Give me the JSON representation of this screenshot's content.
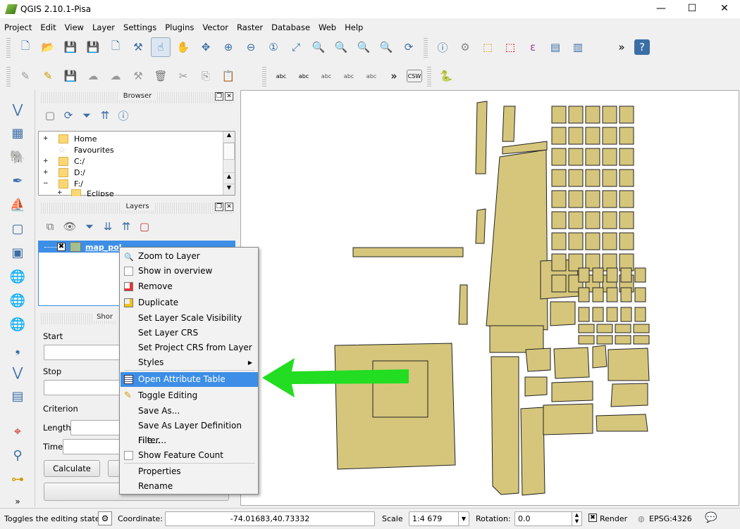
{
  "window": {
    "title": "QGIS 2.10.1-Pisa",
    "minimize": "—",
    "maximize": "☐",
    "close": "✕"
  },
  "menu": [
    "Project",
    "Edit",
    "View",
    "Layer",
    "Settings",
    "Plugins",
    "Vector",
    "Raster",
    "Database",
    "Web",
    "Help"
  ],
  "toolbar_overflow": "»",
  "browser": {
    "title": "Browser",
    "items": [
      {
        "label": "Home",
        "expander": "+"
      },
      {
        "label": "Favourites",
        "expander": ""
      },
      {
        "label": "C:/",
        "expander": "+"
      },
      {
        "label": "D:/",
        "expander": "+"
      },
      {
        "label": "F:/",
        "expander": "−"
      },
      {
        "label": "Eclipse",
        "expander": "+"
      }
    ]
  },
  "layers": {
    "title": "Layers",
    "items": [
      {
        "label": "map_pol",
        "checked": true,
        "swatch": "#a3bf8f"
      }
    ]
  },
  "shortest_path": {
    "title": "Shor",
    "start_label": "Start",
    "stop_label": "Stop",
    "criterion_label": "Criterion",
    "length_label": "Length",
    "time_label": "Time",
    "calculate": "Calculate"
  },
  "context_menu": {
    "items": [
      {
        "label": "Zoom to Layer",
        "icon": "zoom-layer-icon"
      },
      {
        "label": "Show in overview",
        "icon": "checkbox"
      },
      {
        "label": "Remove",
        "icon": "remove-layer-icon"
      },
      {
        "label": "Duplicate",
        "icon": "duplicate-icon"
      },
      {
        "label": "Set Layer Scale Visibility"
      },
      {
        "label": "Set Layer CRS"
      },
      {
        "label": "Set Project CRS from Layer"
      },
      {
        "label": "Styles",
        "submenu": "▶"
      },
      {
        "label": "Open Attribute Table",
        "icon": "table-icon",
        "highlighted": true
      },
      {
        "label": "Toggle Editing",
        "icon": "pencil-icon"
      },
      {
        "label": "Save As..."
      },
      {
        "label": "Save As Layer Definition File..."
      },
      {
        "label": "Filter..."
      },
      {
        "label": "Show Feature Count",
        "icon": "checkbox"
      },
      {
        "label": "Properties"
      },
      {
        "label": "Rename"
      }
    ]
  },
  "annotation": {
    "arrow_color": "#22dd22"
  },
  "map": {
    "polygon_fill": "#d6c67c",
    "polygon_stroke": "#222222"
  },
  "status": {
    "message": "Toggles the editing state of",
    "coordinate_label": "Coordinate:",
    "coordinate": "-74.01683,40.73332",
    "scale_label": "Scale",
    "scale": "1:4 679",
    "rotation_label": "Rotation:",
    "rotation": "0.0",
    "render_label": "Render",
    "render_checked": true,
    "crs": "EPSG:4326"
  }
}
